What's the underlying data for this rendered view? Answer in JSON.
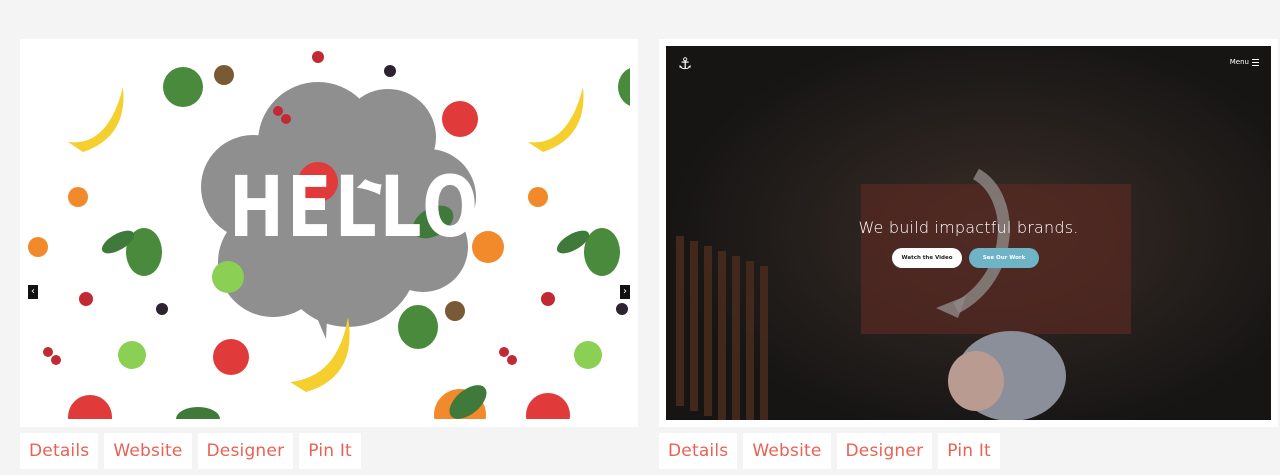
{
  "cards": [
    {
      "links": {
        "details": "Details",
        "website": "Website",
        "designer": "Designer",
        "pin": "Pin It"
      },
      "preview": {
        "headline": "HELLO",
        "prev_icon": "chevron-left-icon",
        "next_icon": "chevron-right-icon",
        "prev_glyph": "‹",
        "next_glyph": "›"
      }
    },
    {
      "links": {
        "details": "Details",
        "website": "Website",
        "designer": "Designer",
        "pin": "Pin It"
      },
      "preview": {
        "logo_icon": "anchor-icon",
        "logo_glyph": "⚓",
        "menu_label": "Menu",
        "headline": "We build impactful brands.",
        "primary_button": "Watch the Video",
        "secondary_button": "See Our Work"
      }
    }
  ],
  "colors": {
    "page_bg": "#f4f4f4",
    "link_text": "#ea6153",
    "hero_button_accent": "#6fb3c7",
    "hero_bg": "#1f1d1c"
  }
}
